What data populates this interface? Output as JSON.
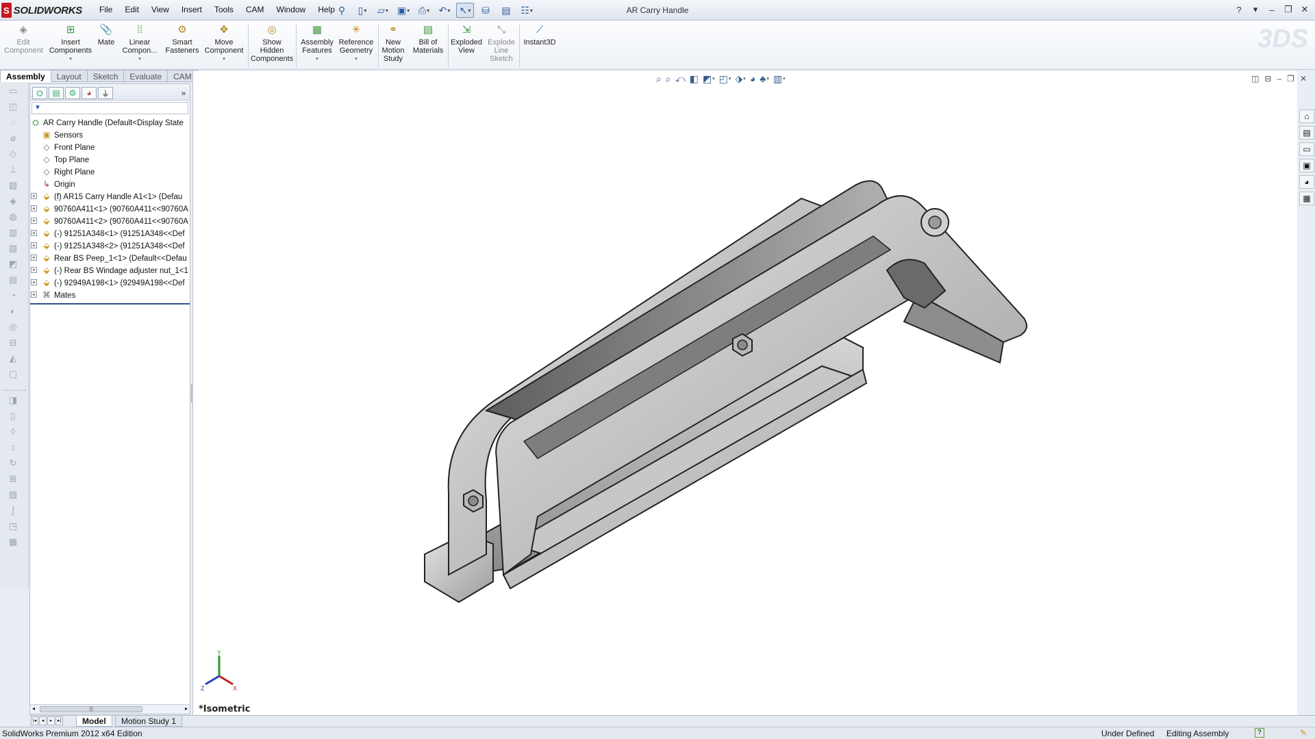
{
  "app": {
    "logo_mark": "S",
    "logo_text": "SOLIDWORKS",
    "document_title": "AR Carry Handle"
  },
  "menu": [
    "File",
    "Edit",
    "View",
    "Insert",
    "Tools",
    "CAM",
    "Window",
    "Help"
  ],
  "command_manager": {
    "items": [
      {
        "label1": "Edit",
        "label2": "Component",
        "icon": "edit-component-icon",
        "enabled": false
      },
      {
        "label1": "Insert",
        "label2": "Components",
        "icon": "insert-components-icon",
        "enabled": true
      },
      {
        "label1": "Mate",
        "label2": "",
        "icon": "mate-icon",
        "enabled": true
      },
      {
        "label1": "Linear",
        "label2": "Compon...",
        "icon": "linear-pattern-icon",
        "enabled": true
      },
      {
        "label1": "Smart",
        "label2": "Fasteners",
        "icon": "smart-fasteners-icon",
        "enabled": true
      },
      {
        "label1": "Move",
        "label2": "Component",
        "icon": "move-component-icon",
        "enabled": true
      },
      {
        "label1": "Show",
        "label2": "Hidden",
        "label3": "Components",
        "icon": "show-hidden-icon",
        "enabled": true
      },
      {
        "label1": "Assembly",
        "label2": "Features",
        "icon": "assembly-features-icon",
        "enabled": true
      },
      {
        "label1": "Reference",
        "label2": "Geometry",
        "icon": "reference-geometry-icon",
        "enabled": true
      },
      {
        "label1": "New",
        "label2": "Motion",
        "label3": "Study",
        "icon": "motion-study-icon",
        "enabled": true
      },
      {
        "label1": "Bill of",
        "label2": "Materials",
        "icon": "bom-icon",
        "enabled": true
      },
      {
        "label1": "Exploded",
        "label2": "View",
        "icon": "exploded-view-icon",
        "enabled": true
      },
      {
        "label1": "Explode",
        "label2": "Line",
        "label3": "Sketch",
        "icon": "explode-line-icon",
        "enabled": false
      },
      {
        "label1": "Instant3D",
        "label2": "",
        "icon": "instant3d-icon",
        "enabled": true
      }
    ],
    "tabs": [
      "Assembly",
      "Layout",
      "Sketch",
      "Evaluate",
      "CAM"
    ],
    "active_tab": "Assembly"
  },
  "feature_tree": {
    "root": "AR Carry Handle  (Default<Display State",
    "items": [
      {
        "label": "Sensors",
        "icon": "sensors-icon",
        "expandable": false
      },
      {
        "label": "Front Plane",
        "icon": "plane-icon",
        "expandable": false
      },
      {
        "label": "Top Plane",
        "icon": "plane-icon",
        "expandable": false
      },
      {
        "label": "Right Plane",
        "icon": "plane-icon",
        "expandable": false
      },
      {
        "label": "Origin",
        "icon": "origin-icon",
        "expandable": false
      },
      {
        "label": "(f) AR15 Carry Handle A1<1> (Defau",
        "icon": "part-icon",
        "expandable": true
      },
      {
        "label": "90760A411<1> (90760A411<<90760A",
        "icon": "part-icon",
        "expandable": true
      },
      {
        "label": "90760A411<2> (90760A411<<90760A",
        "icon": "part-icon",
        "expandable": true
      },
      {
        "label": "(-) 91251A348<1> (91251A348<<Def",
        "icon": "part-icon",
        "expandable": true
      },
      {
        "label": "(-) 91251A348<2> (91251A348<<Def",
        "icon": "part-icon",
        "expandable": true
      },
      {
        "label": "Rear BS Peep_1<1> (Default<<Defau",
        "icon": "part-icon",
        "expandable": true
      },
      {
        "label": "(-) Rear BS Windage adjuster nut_1<1",
        "icon": "part-icon",
        "expandable": true
      },
      {
        "label": "(-) 92949A198<1> (92949A198<<Def",
        "icon": "part-icon",
        "expandable": true
      },
      {
        "label": "Mates",
        "icon": "mates-icon",
        "expandable": true
      }
    ]
  },
  "viewport": {
    "view_name": "*Isometric",
    "triad": {
      "x": "X",
      "y": "Y",
      "z": "Z"
    }
  },
  "bottom_tabs": [
    "Model",
    "Motion Study 1"
  ],
  "active_bottom_tab": "Model",
  "status": {
    "product": "SolidWorks Premium 2012 x64 Edition",
    "definition": "Under Defined",
    "mode": "Editing Assembly",
    "help": "?"
  }
}
